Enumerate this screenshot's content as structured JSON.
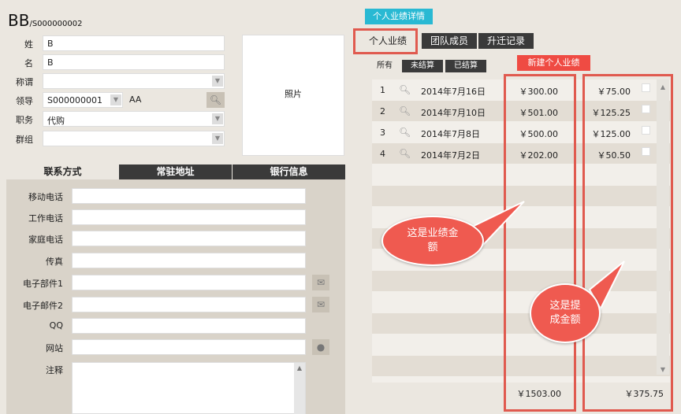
{
  "header": {
    "title": "BB",
    "subtitle": "/S000000002"
  },
  "form": {
    "surname_label": "姓",
    "surname_value": "B",
    "name_label": "名",
    "name_value": "B",
    "title_label": "称谓",
    "title_value": "",
    "leader_label": "领导",
    "leader_code": "S000000001",
    "leader_name": "AA",
    "role_label": "职务",
    "role_value": "代购",
    "group_label": "群组",
    "group_value": ""
  },
  "photo": {
    "label": "照片"
  },
  "left_tabs": [
    {
      "label": "联系方式",
      "active": true
    },
    {
      "label": "常驻地址",
      "active": false
    },
    {
      "label": "银行信息",
      "active": false
    }
  ],
  "contact": {
    "mobile_label": "移动电话",
    "work_label": "工作电话",
    "home_label": "家庭电话",
    "fax_label": "传真",
    "email1_label": "电子部件1",
    "email2_label": "电子邮件2",
    "qq_label": "QQ",
    "website_label": "网站",
    "notes_label": "注释"
  },
  "right": {
    "header_tag": "个人业绩详情",
    "tabs": [
      {
        "label": "个人业绩",
        "active": true
      },
      {
        "label": "团队成员",
        "active": false
      },
      {
        "label": "升迁记录",
        "active": false
      }
    ],
    "filters": [
      "所有",
      "未结算",
      "已结算"
    ],
    "new_button": "新建个人业绩",
    "rows": [
      {
        "num": "1",
        "date": "2014年7月16日",
        "amount": "￥300.00",
        "commission": "￥75.00"
      },
      {
        "num": "2",
        "date": "2014年7月10日",
        "amount": "￥501.00",
        "commission": "￥125.25"
      },
      {
        "num": "3",
        "date": "2014年7月8日",
        "amount": "￥500.00",
        "commission": "￥125.00"
      },
      {
        "num": "4",
        "date": "2014年7月2日",
        "amount": "￥202.00",
        "commission": "￥50.50"
      }
    ],
    "total_amount": "￥1503.00",
    "total_commission": "￥375.75"
  },
  "annotations": {
    "bubble1_line1": "这是业绩金",
    "bubble1_line2": "额",
    "bubble2_line1": "这是提",
    "bubble2_line2": "成金额"
  },
  "colors": {
    "accent_red": "#e05a4f",
    "header_cyan": "#29b9d3",
    "dark_tab": "#3a3a3a"
  },
  "icons": {
    "search": "magnifier-icon",
    "dropdown": "chevron-down-icon",
    "email": "envelope-icon",
    "web": "globe-icon"
  }
}
